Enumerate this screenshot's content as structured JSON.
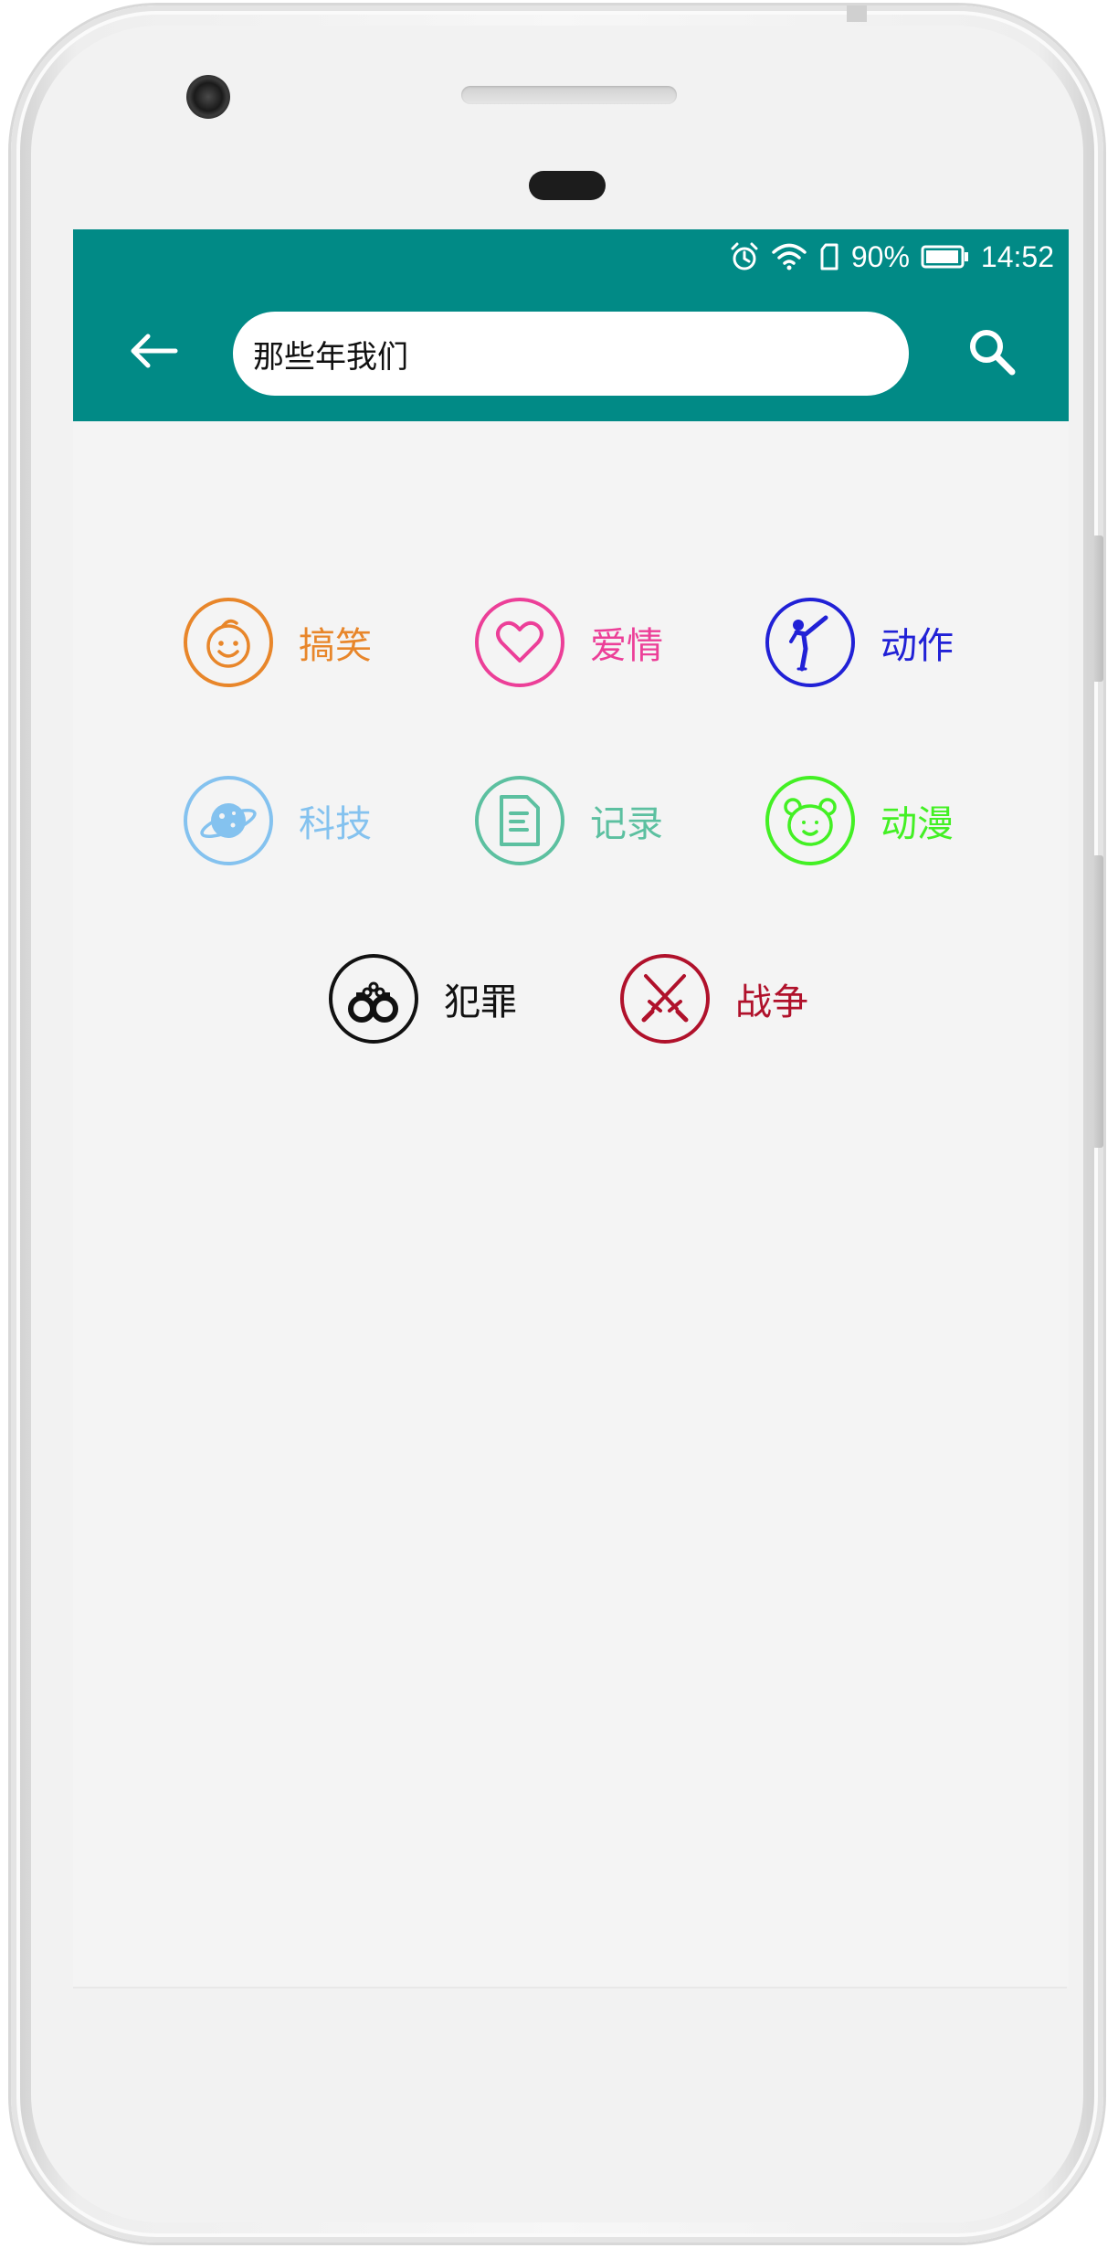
{
  "status_bar": {
    "battery": "90%",
    "time": "14:52",
    "icons": [
      "alarm-icon",
      "wifi-icon",
      "sim-icon",
      "battery-icon"
    ]
  },
  "toolbar": {
    "back_icon": "arrow-left-icon",
    "search_value": "那些年我们",
    "search_icon": "magnifier-icon",
    "accent_color": "#018a86"
  },
  "categories": [
    {
      "label": "搞笑",
      "icon": "smiley-face-icon",
      "color": "#e8862a"
    },
    {
      "label": "爱情",
      "icon": "heart-icon",
      "color": "#ec3f98"
    },
    {
      "label": "动作",
      "icon": "martial-arts-kick-icon",
      "color": "#2121d6"
    },
    {
      "label": "科技",
      "icon": "planet-icon",
      "color": "#84c2ef"
    },
    {
      "label": "记录",
      "icon": "document-icon",
      "color": "#5cc0a0"
    },
    {
      "label": "动漫",
      "icon": "bear-face-icon",
      "color": "#43f024"
    },
    {
      "label": "犯罪",
      "icon": "handcuffs-icon",
      "color": "#111111"
    },
    {
      "label": "战争",
      "icon": "crossed-swords-icon",
      "color": "#b0112b"
    }
  ]
}
